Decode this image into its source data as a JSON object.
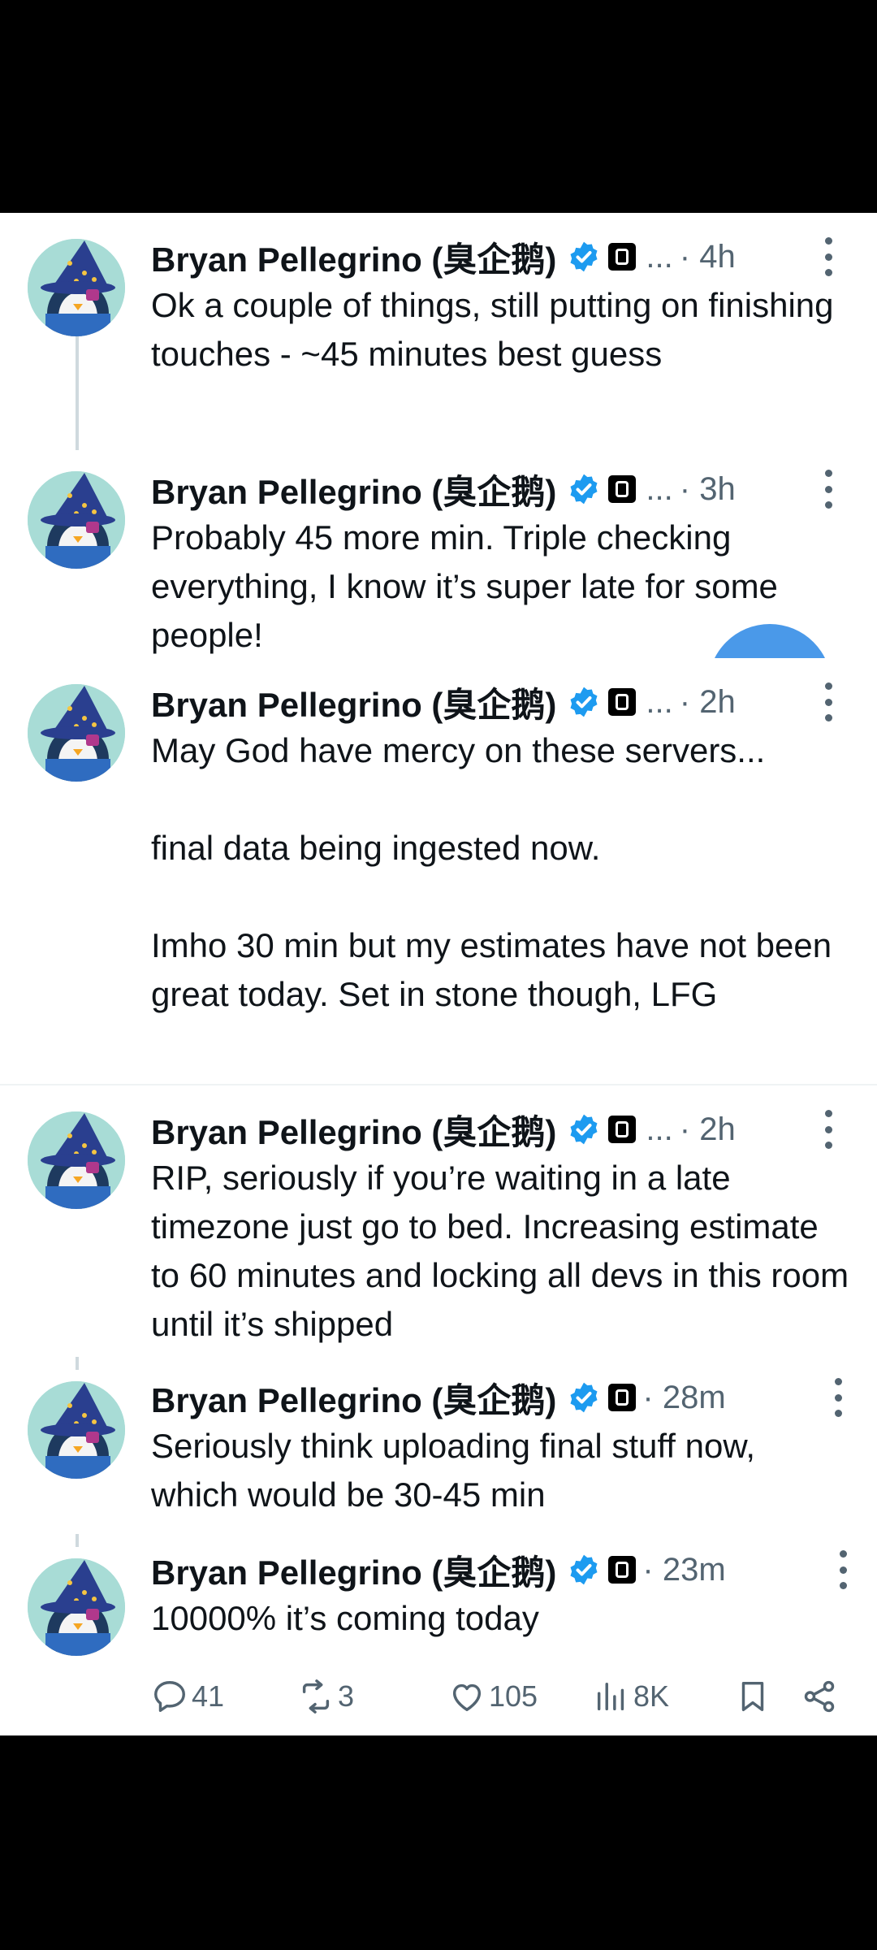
{
  "tweets": [
    {
      "name": "Bryan Pellegrino (臭企鹅)",
      "ellipsis": "...",
      "time": "· 4h",
      "text": "Ok a couple of things, still putting on finishing touches - ~45 minutes best guess"
    },
    {
      "name": "Bryan Pellegrino (臭企鹅)",
      "ellipsis": "...",
      "time": "· 3h",
      "text": "Probably 45 more min. Triple checking everything, I know it’s super late for some people!"
    },
    {
      "name": "Bryan Pellegrino (臭企鹅)",
      "ellipsis": "...",
      "time": "· 2h",
      "text": "May God have mercy on these servers...\n\nfinal data being ingested now.\n\nImho 30 min but my estimates have not been great today. Set in stone though, LFG"
    },
    {
      "name": "Bryan Pellegrino (臭企鹅)",
      "ellipsis": "...",
      "time": "· 2h",
      "text": "RIP, seriously if you’re waiting in a late timezone just go to bed. Increasing estimate to 60 minutes and locking all devs in this room until it’s shipped"
    },
    {
      "name": "Bryan Pellegrino (臭企鹅)",
      "ellipsis": "",
      "time": "· 28m",
      "text": "Seriously think uploading final stuff now, which would be 30-45 min"
    },
    {
      "name": "Bryan Pellegrino (臭企鹅)",
      "ellipsis": "",
      "time": "· 23m",
      "text": "10000% it’s coming today"
    }
  ],
  "actions": {
    "replies": "41",
    "reposts": "3",
    "likes": "105",
    "views": "8K"
  },
  "colors": {
    "verified": "#1d9bf0",
    "fab": "#4a99e9",
    "muted": "#536471"
  },
  "icons": [
    "verified-badge-icon",
    "affiliate-badge-icon",
    "more-options-icon",
    "reply-icon",
    "repost-icon",
    "like-icon",
    "views-icon",
    "bookmark-icon",
    "share-icon"
  ]
}
